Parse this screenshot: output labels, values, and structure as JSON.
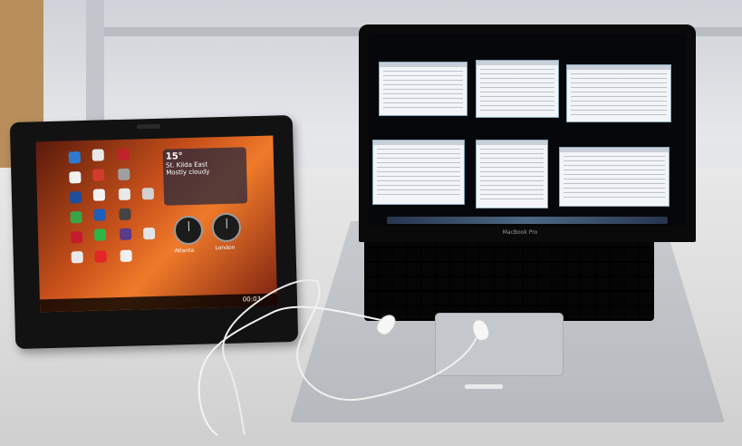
{
  "tablet": {
    "weather": {
      "temperature": "15°",
      "location": "St. Kilda East",
      "condition": "Mostly cloudy"
    },
    "clocks": [
      "Atlanta",
      "London"
    ],
    "status_time": "00:03"
  },
  "laptop": {
    "model_label": "MacBook Pro"
  },
  "colors": {
    "tablet_wallpaper": "#e0612a",
    "laptop_body": "#b8bbbf",
    "desk": "#dcdcdc"
  }
}
